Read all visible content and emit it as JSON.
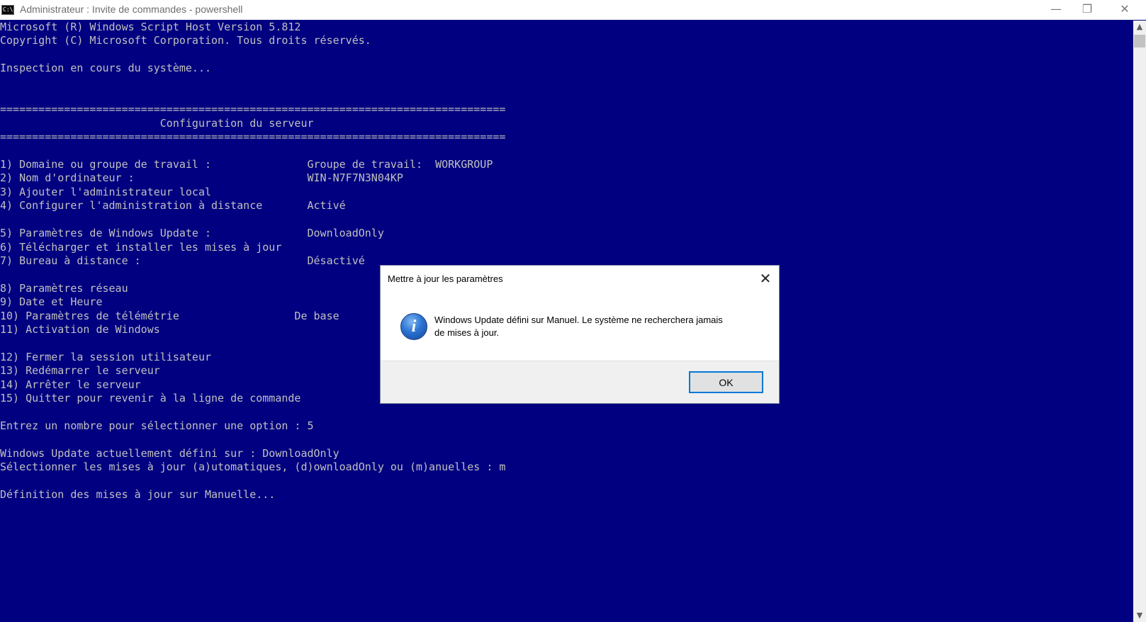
{
  "window": {
    "title": "Administrateur : Invite de commandes - powershell",
    "icon_label": "C:\\",
    "minimize_glyph": "—",
    "restore_glyph": "❐",
    "close_glyph": "✕"
  },
  "console": {
    "lines": [
      "Microsoft (R) Windows Script Host Version 5.812",
      "Copyright (C) Microsoft Corporation. Tous droits réservés.",
      "",
      "Inspection en cours du système...",
      "",
      "",
      "===============================================================================",
      "                         Configuration du serveur",
      "===============================================================================",
      "",
      "1) Domaine ou groupe de travail :               Groupe de travail:  WORKGROUP",
      "2) Nom d'ordinateur :                           WIN-N7F7N3N04KP",
      "3) Ajouter l'administrateur local",
      "4) Configurer l'administration à distance       Activé",
      "",
      "5) Paramètres de Windows Update :               DownloadOnly",
      "6) Télécharger et installer les mises à jour",
      "7) Bureau à distance :                          Désactivé",
      "",
      "8) Paramètres réseau",
      "9) Date et Heure",
      "10) Paramètres de télémétrie                  De base",
      "11) Activation de Windows",
      "",
      "12) Fermer la session utilisateur",
      "13) Redémarrer le serveur",
      "14) Arrêter le serveur",
      "15) Quitter pour revenir à la ligne de commande",
      "",
      "Entrez un nombre pour sélectionner une option : 5",
      "",
      "Windows Update actuellement défini sur : DownloadOnly",
      "Sélectionner les mises à jour (a)utomatiques, (d)ownloadOnly ou (m)anuelles : m",
      "",
      "Définition des mises à jour sur Manuelle..."
    ]
  },
  "dialog": {
    "title": "Mettre à jour les paramètres",
    "message_line1": "Windows Update défini sur Manuel.  Le système ne recherchera jamais",
    "message_line2": "de mises à jour.",
    "ok_label": "OK",
    "close_glyph": "✕",
    "icon_glyph": "i"
  },
  "scrollbar": {
    "up_glyph": "▲",
    "down_glyph": "▼"
  },
  "colors": {
    "console_background": "#000080",
    "console_text": "#c0c0c0",
    "accent": "#0078d7"
  },
  "icons": [
    "cmd-icon",
    "minimize-icon",
    "restore-icon",
    "close-icon",
    "info-icon",
    "dialog-close-icon"
  ]
}
